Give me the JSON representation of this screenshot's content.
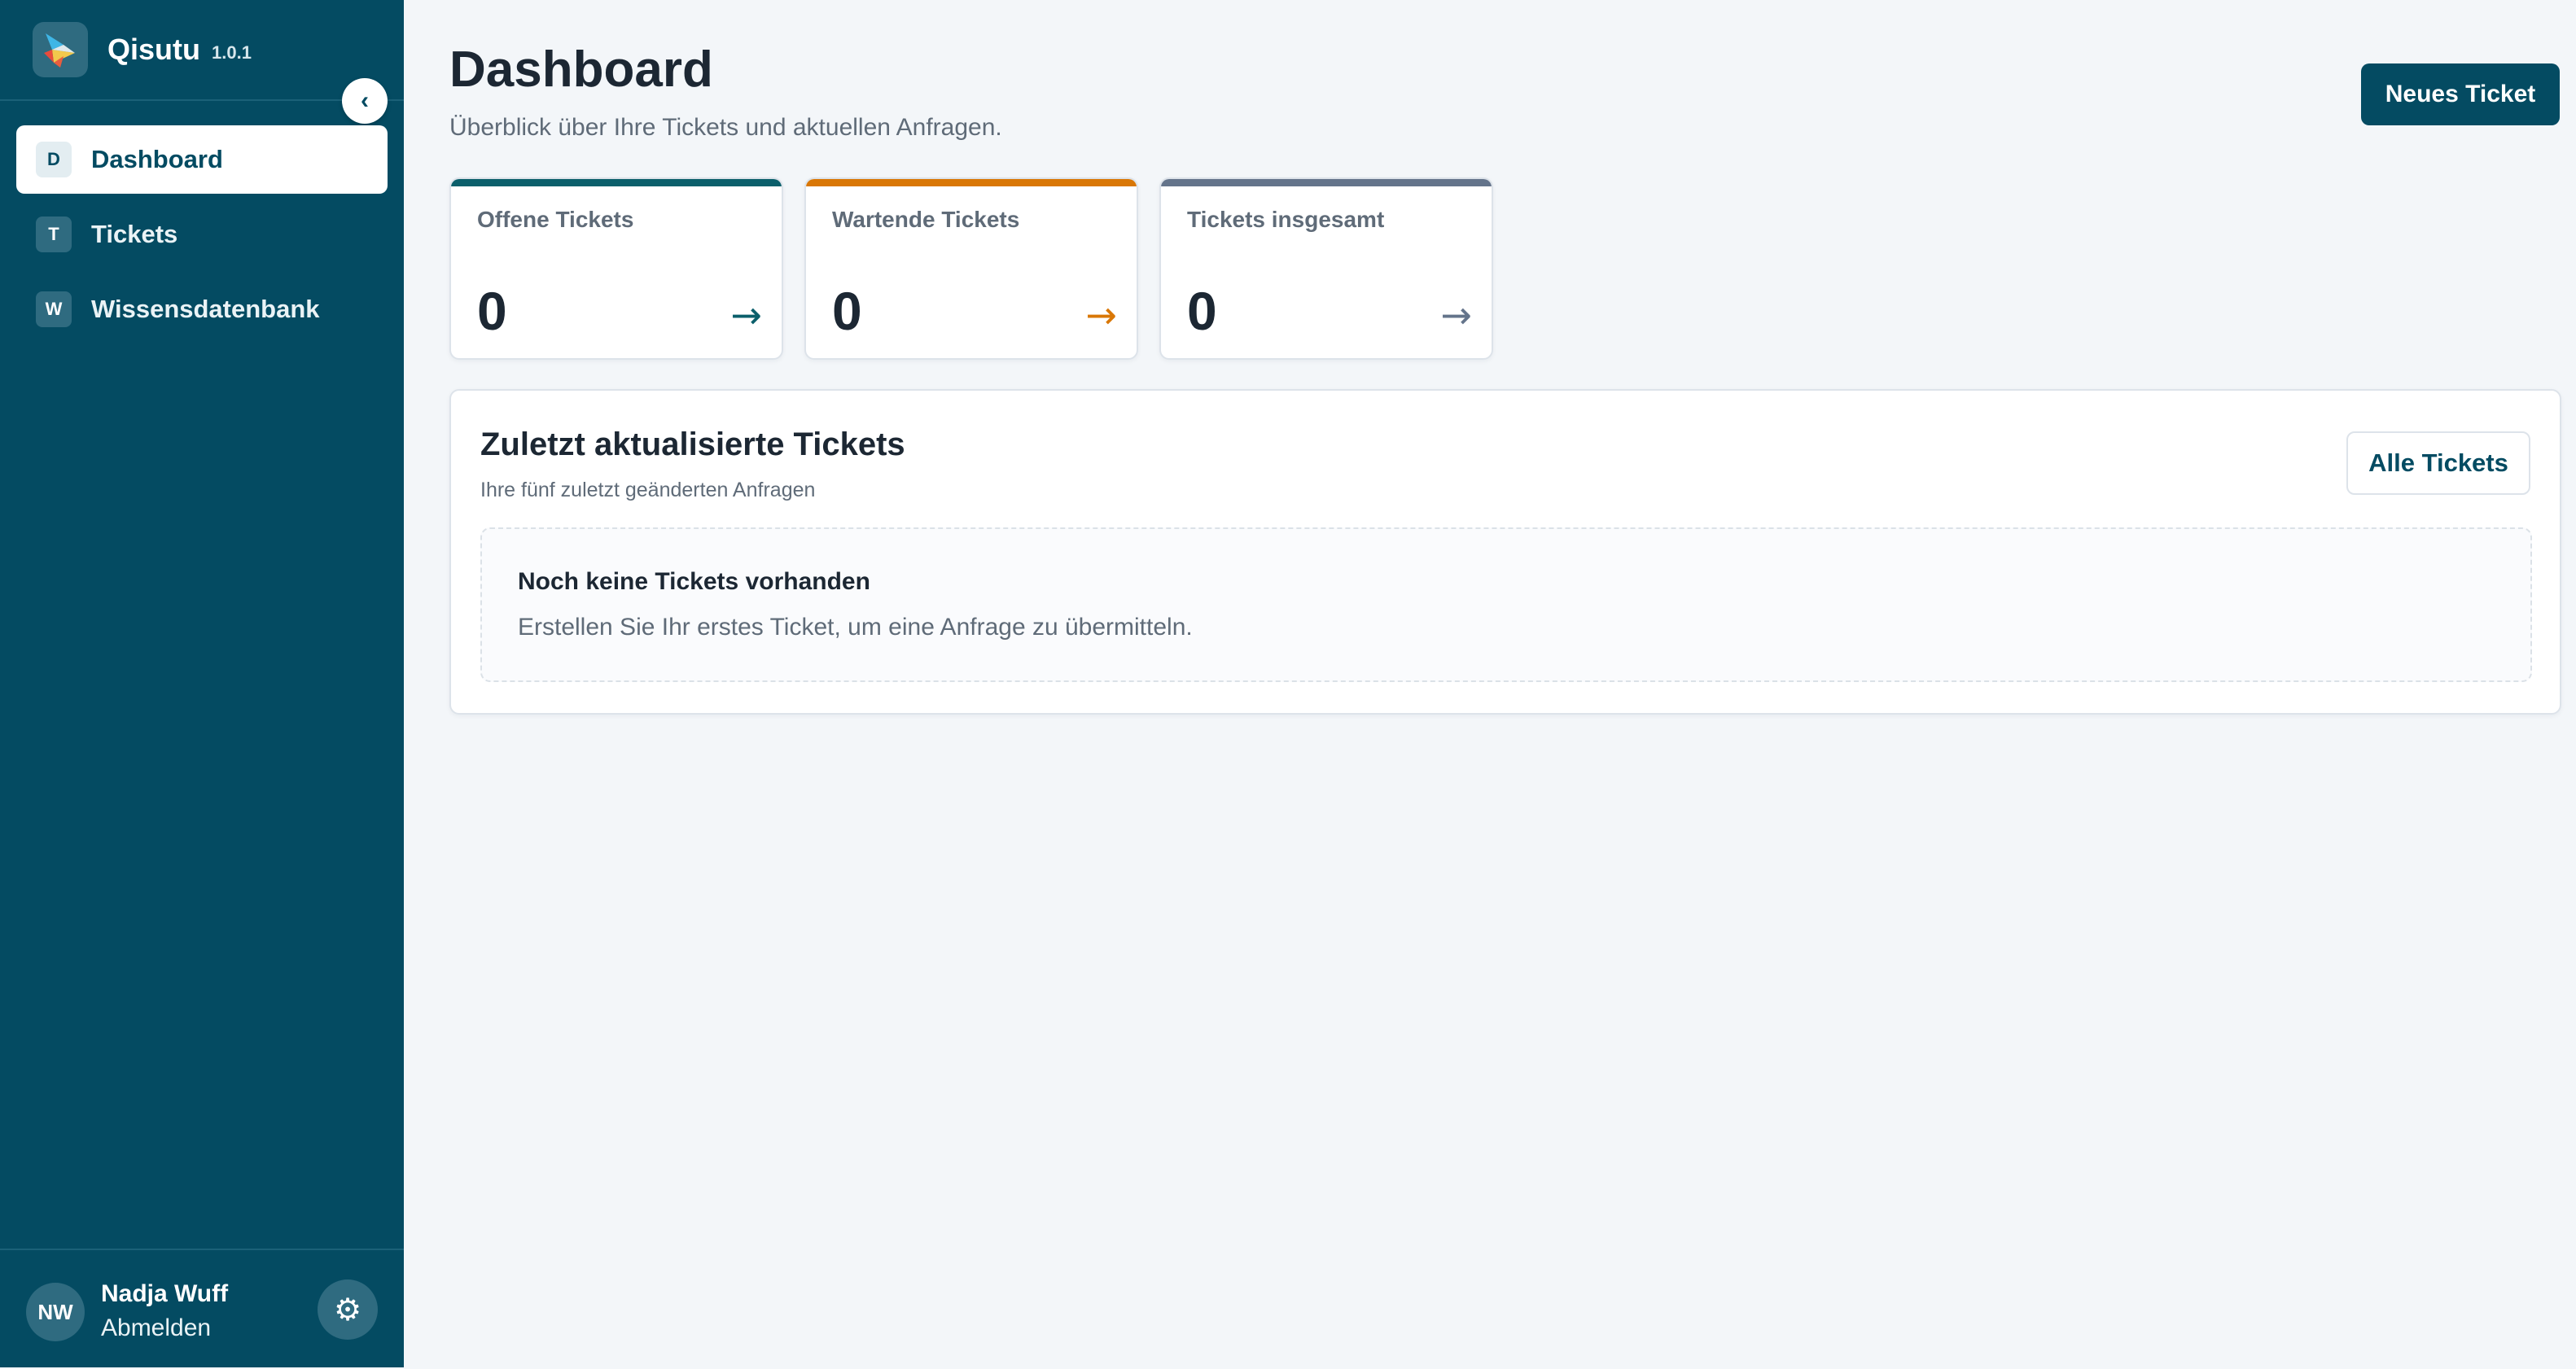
{
  "app": {
    "name": "Qisutu",
    "version": "1.0.1"
  },
  "sidebar": {
    "collapse_icon": "‹",
    "items": [
      {
        "letter": "D",
        "label": "Dashboard",
        "active": true
      },
      {
        "letter": "T",
        "label": "Tickets",
        "active": false
      },
      {
        "letter": "W",
        "label": "Wissensdatenbank",
        "active": false
      }
    ],
    "user": {
      "initials": "NW",
      "name": "Nadja Wuff",
      "logout_label": "Abmelden"
    },
    "settings_icon": "⚙"
  },
  "header": {
    "title": "Dashboard",
    "subtitle": "Überblick über Ihre Tickets und aktuellen Anfragen.",
    "new_ticket_label": "Neues Ticket"
  },
  "stats": [
    {
      "label": "Offene Tickets",
      "value": "0",
      "color": "#0b5f6b",
      "arrow": "→"
    },
    {
      "label": "Wartende Tickets",
      "value": "0",
      "color": "#d97706",
      "arrow": "→"
    },
    {
      "label": "Tickets insgesamt",
      "value": "0",
      "color": "#64748b",
      "arrow": "→"
    }
  ],
  "recent": {
    "title": "Zuletzt aktualisierte Tickets",
    "subtitle": "Ihre fünf zuletzt geänderten Anfragen",
    "all_tickets_label": "Alle Tickets",
    "empty_title": "Noch keine Tickets vorhanden",
    "empty_text": "Erstellen Sie Ihr erstes Ticket, um eine Anfrage zu übermitteln."
  },
  "colors": {
    "sidebar_bg": "#044b62",
    "accent_open": "#0b5f6b",
    "accent_waiting": "#d97706",
    "accent_total": "#64748b"
  }
}
